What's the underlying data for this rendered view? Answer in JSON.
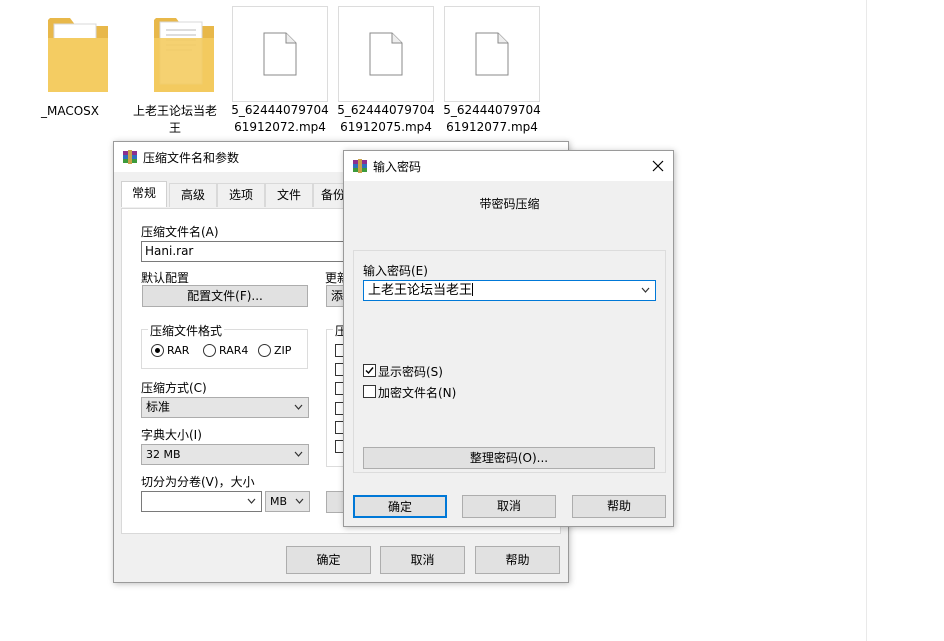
{
  "desktop": {
    "files": [
      {
        "name": "__MACOSX",
        "type": "folder"
      },
      {
        "name": "上老王论坛当老王",
        "type": "folder"
      },
      {
        "name": "5_6244407970461912072.mp4",
        "line1": "5_62444079704",
        "line2": "61912072.mp4",
        "type": "video"
      },
      {
        "name": "5_6244407970461912075.mp4",
        "line1": "5_62444079704",
        "line2": "61912075.mp4",
        "type": "video"
      },
      {
        "name": "5_6244407970461912077.mp4",
        "line1": "5_62444079704",
        "line2": "61912077.mp4",
        "type": "video"
      }
    ],
    "folder1_label": "_MACOSX",
    "folder2_line1": "上老王论坛当老",
    "folder2_line2": "王"
  },
  "archive_dialog": {
    "title": "压缩文件名和参数",
    "tabs": [
      "常规",
      "高级",
      "选项",
      "文件",
      "备份"
    ],
    "archive_name_label": "压缩文件名(A)",
    "archive_name_value": "Hani.rar",
    "default_profile_label": "默认配置",
    "profile_button": "配置文件(F)...",
    "update_label": "更新",
    "add_button": "添",
    "format_group_label": "压缩文件格式",
    "formats": [
      "RAR",
      "RAR4",
      "ZIP"
    ],
    "selected_format": "RAR",
    "options_group_label": "压",
    "method_label": "压缩方式(C)",
    "method_value": "标准",
    "dict_label": "字典大小(I)",
    "dict_value": "32 MB",
    "split_label": "切分为分卷(V)，大小",
    "split_value": "",
    "split_unit": "MB",
    "ok": "确定",
    "cancel": "取消",
    "help": "帮助"
  },
  "password_dialog": {
    "title": "输入密码",
    "heading": "带密码压缩",
    "password_label": "输入密码(E)",
    "password_value": "上老王论坛当老王",
    "show_password_label": "显示密码(S)",
    "show_password_checked": true,
    "encrypt_names_label": "加密文件名(N)",
    "encrypt_names_checked": false,
    "organize_button": "整理密码(O)...",
    "ok": "确定",
    "cancel": "取消",
    "help": "帮助"
  }
}
